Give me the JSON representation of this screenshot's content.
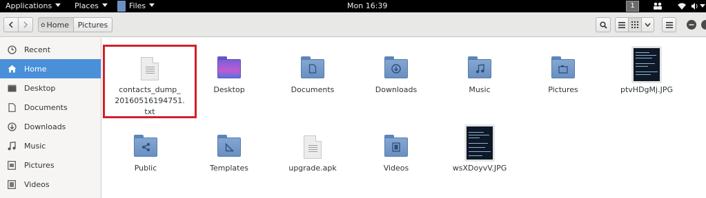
{
  "topbar": {
    "applications": "Applications",
    "places": "Places",
    "files": "Files",
    "clock": "Mon 16:39",
    "workspace": "1"
  },
  "headerbar": {
    "breadcrumbs": [
      "Home",
      "Pictures"
    ]
  },
  "sidebar": {
    "items": [
      {
        "label": "Recent",
        "icon": "recent-icon"
      },
      {
        "label": "Home",
        "icon": "home-icon",
        "active": true
      },
      {
        "label": "Desktop",
        "icon": "desktop-icon"
      },
      {
        "label": "Documents",
        "icon": "documents-icon"
      },
      {
        "label": "Downloads",
        "icon": "downloads-icon"
      },
      {
        "label": "Music",
        "icon": "music-icon"
      },
      {
        "label": "Pictures",
        "icon": "pictures-icon"
      },
      {
        "label": "Videos",
        "icon": "videos-icon"
      }
    ]
  },
  "files": [
    {
      "name": "contacts_dump_20160516194751.txt",
      "line1": "contacts_dump_",
      "line2": "20160516194751.",
      "line3": "txt",
      "type": "text-file",
      "highlighted": true
    },
    {
      "name": "Desktop",
      "type": "folder-desktop"
    },
    {
      "name": "Documents",
      "type": "folder-documents"
    },
    {
      "name": "Downloads",
      "type": "folder-downloads"
    },
    {
      "name": "Music",
      "type": "folder-music"
    },
    {
      "name": "Pictures",
      "type": "folder-pictures"
    },
    {
      "name": "ptvHDgMj.JPG",
      "type": "image-thumbnail"
    },
    {
      "name": "Public",
      "type": "folder-public"
    },
    {
      "name": "Templates",
      "type": "folder-templates"
    },
    {
      "name": "upgrade.apk",
      "type": "package-file"
    },
    {
      "name": "Videos",
      "type": "folder-videos"
    },
    {
      "name": "wsXDoyvV.JPG",
      "type": "image-thumbnail"
    }
  ],
  "colors": {
    "selection": "#4a90d9",
    "folder": "#6a90c2",
    "highlight_box": "#d0202a"
  }
}
